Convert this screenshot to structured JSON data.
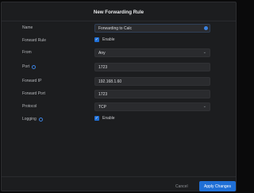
{
  "dialog": {
    "title": "New Forwarding Rule",
    "fields": {
      "name": {
        "label": "Name",
        "value": "Forwarding to Calc"
      },
      "forward_rule": {
        "label": "Forward Rule",
        "checkbox_label": "Enable",
        "checked": true
      },
      "from": {
        "label": "From",
        "value": "Any"
      },
      "port": {
        "label": "Port",
        "value": "1723"
      },
      "forward_ip": {
        "label": "Forward IP",
        "value": "192.168.1.60"
      },
      "forward_port": {
        "label": "Forward Port",
        "value": "1723"
      },
      "protocol": {
        "label": "Protocol",
        "value": "TCP"
      },
      "logging": {
        "label": "Logging",
        "checkbox_label": "Enable",
        "checked": true
      }
    },
    "buttons": {
      "cancel": "Cancel",
      "apply": "Apply Changes"
    }
  },
  "colors": {
    "accent": "#1f6fd6",
    "background": "#1c1d1f",
    "field": "#2a2b2e"
  },
  "icons": [
    "info-icon",
    "check-icon",
    "chevron-down-icon",
    "edit-icon"
  ]
}
